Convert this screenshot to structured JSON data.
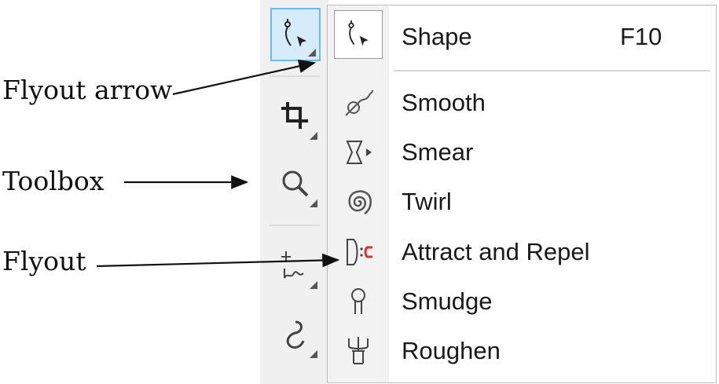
{
  "callouts": {
    "flyout_arrow": "Flyout arrow",
    "toolbox": "Toolbox",
    "flyout": "Flyout"
  },
  "toolbox": {
    "tools": [
      {
        "icon": "shape-tool-icon",
        "active": true,
        "has_flyout": true
      },
      {
        "icon": "crop-tool-icon",
        "active": false,
        "has_flyout": true
      },
      {
        "icon": "zoom-tool-icon",
        "active": false,
        "has_flyout": true
      },
      {
        "icon": "freehand-tool-icon",
        "active": false,
        "has_flyout": true
      },
      {
        "icon": "curve-tool-icon",
        "active": false,
        "has_flyout": true
      }
    ]
  },
  "flyout": {
    "items": [
      {
        "label": "Shape",
        "shortcut": "F10",
        "icon": "shape-icon",
        "current": true
      },
      {
        "label": "Smooth",
        "icon": "smooth-icon"
      },
      {
        "label": "Smear",
        "icon": "smear-icon"
      },
      {
        "label": "Twirl",
        "icon": "twirl-icon"
      },
      {
        "label": "Attract and Repel",
        "icon": "attract-repel-icon"
      },
      {
        "label": "Smudge",
        "icon": "smudge-icon"
      },
      {
        "label": "Roughen",
        "icon": "roughen-icon"
      }
    ]
  },
  "colors": {
    "active_tool_bg": "#d6ecfb",
    "active_tool_border": "#6fb8ec",
    "toolbox_bg": "#f0f0f0",
    "attract_repel_accent": "#e0332b"
  }
}
